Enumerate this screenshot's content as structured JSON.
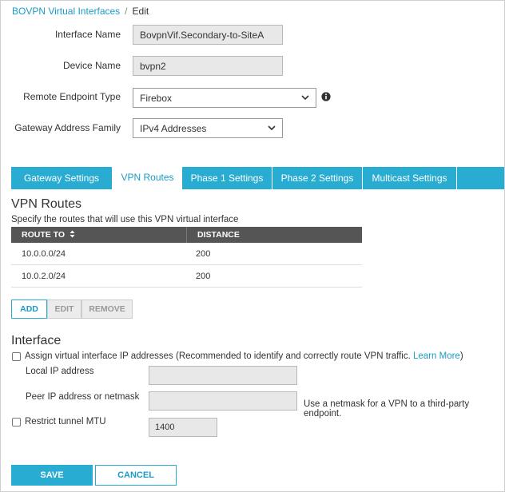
{
  "breadcrumb": {
    "parent": "BOVPN Virtual Interfaces",
    "separator": "/",
    "current": "Edit"
  },
  "form": {
    "interface_name": {
      "label": "Interface Name",
      "value": "BovpnVif.Secondary-to-SiteA"
    },
    "device_name": {
      "label": "Device Name",
      "value": "bvpn2"
    },
    "remote_endpoint_type": {
      "label": "Remote Endpoint Type",
      "value": "Firebox"
    },
    "gateway_address_family": {
      "label": "Gateway Address Family",
      "value": "IPv4 Addresses"
    }
  },
  "tabs": [
    {
      "label": "Gateway Settings"
    },
    {
      "label": "VPN Routes"
    },
    {
      "label": "Phase 1 Settings"
    },
    {
      "label": "Phase 2 Settings"
    },
    {
      "label": "Multicast Settings"
    }
  ],
  "active_tab": "VPN Routes",
  "vpn_routes": {
    "title": "VPN Routes",
    "description": "Specify the routes that will use this VPN virtual interface",
    "columns": [
      "ROUTE TO",
      "DISTANCE"
    ],
    "rows": [
      {
        "route_to": "10.0.0.0/24",
        "distance": "200"
      },
      {
        "route_to": "10.0.2.0/24",
        "distance": "200"
      }
    ],
    "buttons": {
      "add": "ADD",
      "edit": "EDIT",
      "remove": "REMOVE"
    }
  },
  "interface": {
    "title": "Interface",
    "assign_label": "Assign virtual interface IP addresses (Recommended to identify and correctly route VPN traffic.",
    "learn_more": "Learn More",
    "learn_more_suffix": ")",
    "assign_checked": false,
    "local_ip_label": "Local IP address",
    "local_ip_value": "",
    "peer_ip_label": "Peer IP address or netmask",
    "peer_ip_value": "",
    "peer_hint": "Use a netmask for a VPN to a third-party endpoint.",
    "restrict_mtu_label": "Restrict tunnel MTU",
    "restrict_mtu_checked": false,
    "mtu_value": "1400"
  },
  "actions": {
    "save": "SAVE",
    "cancel": "CANCEL"
  },
  "colors": {
    "accent": "#29acd1",
    "link": "#1a9bc7",
    "table_header": "#555555"
  }
}
